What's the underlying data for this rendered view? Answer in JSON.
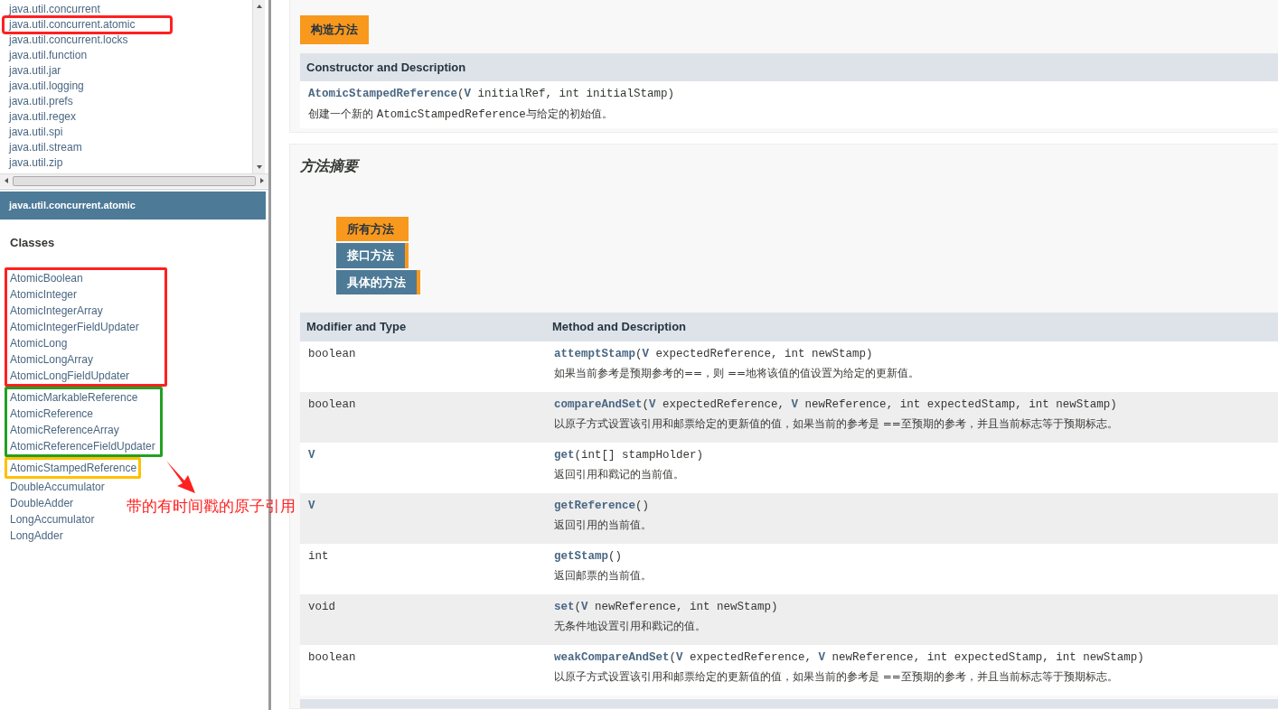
{
  "package_list": {
    "items": [
      {
        "label": "java.util.concurrent"
      },
      {
        "label": "java.util.concurrent.atomic",
        "color": "#ff2020"
      },
      {
        "label": "java.util.concurrent.locks"
      },
      {
        "label": "java.util.function"
      },
      {
        "label": "java.util.jar"
      },
      {
        "label": "java.util.logging"
      },
      {
        "label": "java.util.prefs"
      },
      {
        "label": "java.util.regex"
      },
      {
        "label": "java.util.spi"
      },
      {
        "label": "java.util.stream"
      },
      {
        "label": "java.util.zip"
      }
    ]
  },
  "package_frame": {
    "title": "java.util.concurrent.atomic",
    "heading": "Classes",
    "class_groups": [
      {
        "color": "#ff2020",
        "items": [
          "AtomicBoolean",
          "AtomicInteger",
          "AtomicIntegerArray",
          "AtomicIntegerFieldUpdater",
          "AtomicLong",
          "AtomicLongArray",
          "AtomicLongFieldUpdater"
        ]
      },
      {
        "color": "#22a022",
        "items": [
          "AtomicMarkableReference",
          "AtomicReference",
          "AtomicReferenceArray",
          "AtomicReferenceFieldUpdater"
        ]
      },
      {
        "color": "#ffc000",
        "items": [
          "AtomicStampedReference"
        ]
      },
      {
        "items": [
          "DoubleAccumulator",
          "DoubleAdder",
          "LongAccumulator",
          "LongAdder"
        ]
      }
    ],
    "callout": {
      "text": "带的有时间戳的原子引用"
    }
  },
  "constructor_summary": {
    "heading": "构造方法",
    "columns": [
      "Constructor and Description"
    ],
    "rows": [
      {
        "signature": "**AtomicStampedReference**(**V** initialRef, int initialStamp)",
        "description": [
          {
            "kind": "text",
            "text": "创建一个新的 "
          },
          {
            "kind": "code",
            "text": "AtomicStampedReference"
          },
          {
            "kind": "text",
            "text": "与给定的初始值。"
          }
        ]
      }
    ]
  },
  "method_summary": {
    "title": "方法摘要",
    "tabs": [
      {
        "label": "所有方法",
        "selected": true
      },
      {
        "label": "接口方法",
        "selected": false
      },
      {
        "label": "具体的方法",
        "selected": false
      }
    ],
    "columns": [
      "Modifier and Type",
      "Method and Description"
    ],
    "rows": [
      {
        "modifier": "boolean",
        "signature": "**attemptStamp**(**V** expectedReference, int newStamp)",
        "description": "如果当前参考是预期参考的==，则 ==地将该值的值设置为给定的更新值。"
      },
      {
        "modifier": "boolean",
        "signature": "**compareAndSet**(**V** expectedReference, **V** newReference, int expectedStamp, int newStamp)",
        "description": "以原子方式设置该引用和邮票给定的更新值的值，如果当前的参考是 ==至预期的参考，并且当前标志等于预期标志。"
      },
      {
        "modifier": "**V**",
        "signature": "**get**(int[] stampHolder)",
        "description": "返回引用和戳记的当前值。"
      },
      {
        "modifier": "**V**",
        "signature": "**getReference**()",
        "description": "返回引用的当前值。"
      },
      {
        "modifier": "int",
        "signature": "**getStamp**()",
        "description": "返回邮票的当前值。"
      },
      {
        "modifier": "void",
        "signature": "**set**(**V** newReference, int newStamp)",
        "description": "无条件地设置引用和戳记的值。"
      },
      {
        "modifier": "boolean",
        "signature": "**weakCompareAndSet**(**V** expectedReference, **V** newReference, int expectedStamp, int newStamp)",
        "description": "以原子方式设置该引用和邮票给定的更新值的值，如果当前的参考是 ==至预期的参考，并且当前标志等于预期标志。"
      }
    ]
  }
}
